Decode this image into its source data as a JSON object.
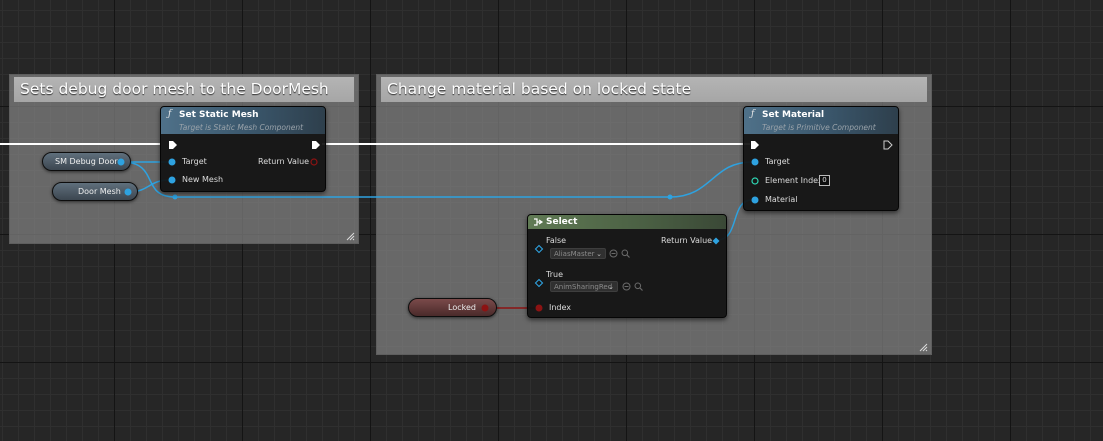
{
  "comments": {
    "debug_door": "Sets debug door mesh to the DoorMesh",
    "material": "Change material based on locked state"
  },
  "set_static_mesh": {
    "title": "Set Static Mesh",
    "subtitle": "Target is Static Mesh Component",
    "pins": {
      "target": "Target",
      "new_mesh": "New Mesh",
      "return_value": "Return Value"
    }
  },
  "set_material": {
    "title": "Set Material",
    "subtitle": "Target is Primitive Component",
    "pins": {
      "target": "Target",
      "element_index": "Element Index",
      "element_index_value": "0",
      "material": "Material"
    }
  },
  "select": {
    "title": "Select",
    "pins": {
      "false_label": "False",
      "false_value": "AliasMaster",
      "true_label": "True",
      "true_value": "AnimSharingRed",
      "index": "Index",
      "return_value": "Return Value"
    }
  },
  "variables": {
    "sm_debug_door": "SM Debug Door",
    "door_mesh": "Door Mesh",
    "locked": "Locked"
  },
  "colors": {
    "object_pin": "#2ea2e0",
    "bool_pin": "#8c1313",
    "exec_wire": "#ffffff",
    "set_material_output_exec": "#cccccc"
  },
  "icons": [
    "function-icon",
    "select-icon",
    "dropdown-arrow-icon",
    "use-selected-asset-icon",
    "browse-asset-icon",
    "resize-grip-icon"
  ]
}
